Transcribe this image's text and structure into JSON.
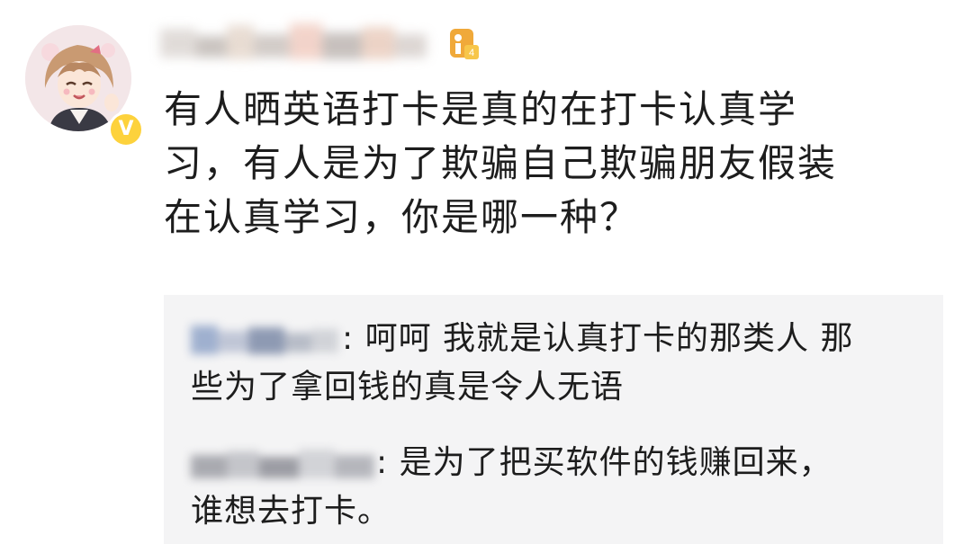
{
  "post": {
    "author": {
      "avatar": "anime-girl-avatar",
      "verified_icon": "v-verified-icon",
      "verified_mark": "V",
      "level_icon": "user-level-icon",
      "level_mark": "4"
    },
    "content_lines": [
      "有人晒英语打卡是真的在打卡认真学",
      "习，有人是为了欺骗自己欺骗朋友假装",
      "在认真学习，你是哪一种？"
    ]
  },
  "comments": [
    {
      "author_name_blurred": true,
      "separator": ":",
      "lines": [
        "呵呵 我就是认真打卡的那类人 那",
        "些为了拿回钱的真是令人无语"
      ]
    },
    {
      "author_name_blurred": true,
      "separator": ":",
      "lines": [
        "是为了把买软件的钱赚回来，",
        "谁想去打卡。"
      ]
    }
  ],
  "colors": {
    "background": "#ffffff",
    "comment_box": "#f4f4f5",
    "text": "#1d1d1d",
    "verified_badge": "#fdd23c",
    "level_icon": "#f0a93a"
  }
}
